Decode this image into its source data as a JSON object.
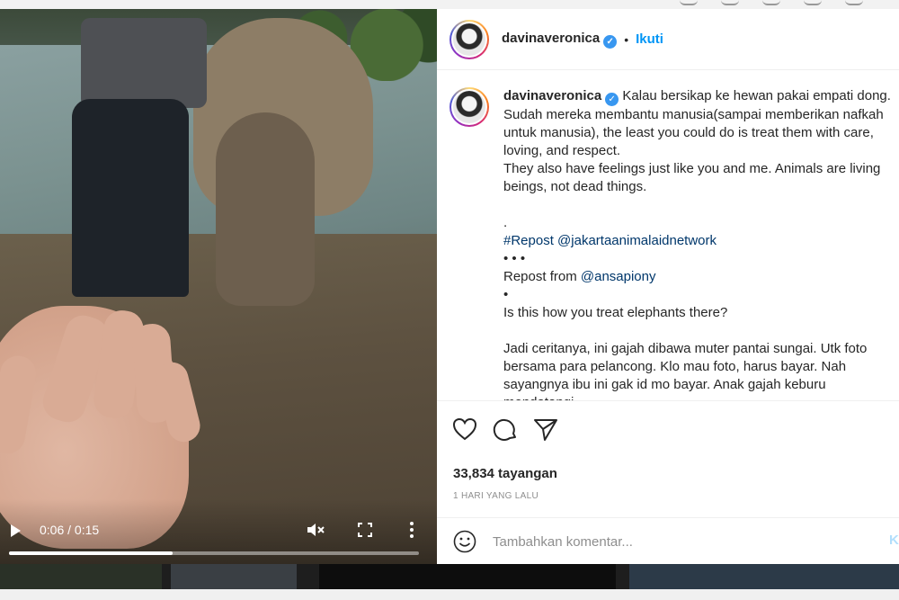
{
  "topbar": {
    "ghost_text": ""
  },
  "video": {
    "time": "0:06 / 0:15",
    "progress": 0.4,
    "play_icon": "play-icon",
    "mute_icon": "mute-icon",
    "fullscreen_icon": "fullscreen-icon",
    "more_icon": "more-vertical-icon"
  },
  "header": {
    "username": "davinaveronica",
    "separator": "•",
    "follow_label": "Ikuti"
  },
  "caption": {
    "username": "davinaveronica",
    "paragraph1": "Kalau bersikap ke hewan pakai empati dong. Sudah mereka membantu manusia(sampai memberikan nafkah untuk manusia), the least you could do is treat them with care, loving, and respect.",
    "paragraph2": "They also have feelings just like you and me. Animals are living beings, not dead things.",
    "dot1": ".",
    "repost_tag": "#Repost",
    "repost_handle": "@jakartaanimalaidnetwork",
    "dots": "• • •",
    "repost_from": "Repost from",
    "repost_from_handle": "@ansapiony",
    "dot2": "•",
    "question": "Is this how you treat elephants there?",
    "paragraph3": "Jadi ceritanya, ini gajah dibawa muter pantai sungai. Utk foto bersama para pelancong. Klo mau foto, harus bayar. Nah sayangnya ibu ini gak id mo bayar. Anak gajah keburu mendatangi"
  },
  "actions": {
    "like_icon": "heart-icon",
    "comment_icon": "comment-icon",
    "share_icon": "paper-plane-icon",
    "views": "33,834 tayangan",
    "time_ago": "1 HARI YANG LALU"
  },
  "comment": {
    "placeholder": "Tambahkan komentar...",
    "post_label": "K",
    "emoji_icon": "smiley-icon"
  },
  "colors": {
    "accent": "#0095f6",
    "verified": "#3897f0",
    "text": "#262626",
    "muted": "#8e8e8e"
  }
}
